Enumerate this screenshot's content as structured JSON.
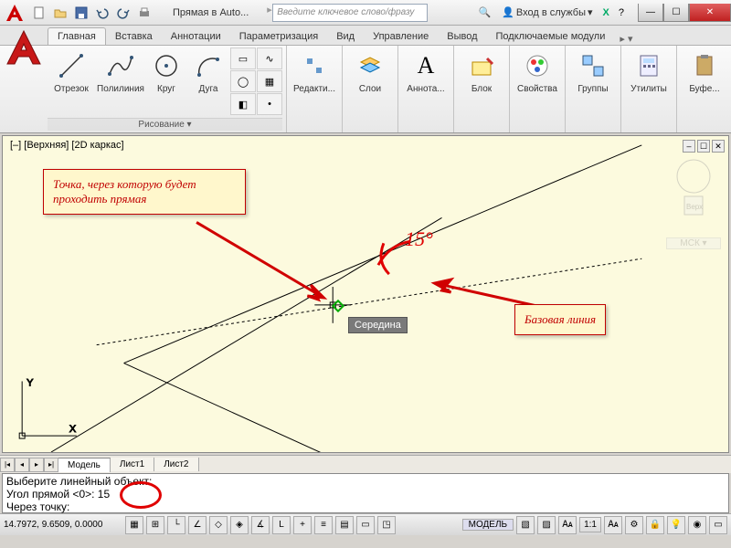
{
  "title": "Прямая в Auto...",
  "search_placeholder": "Введите ключевое слово/фразу",
  "login_label": "Вход в службы",
  "tabs": {
    "home": "Главная",
    "insert": "Вставка",
    "annotate": "Аннотации",
    "parametric": "Параметризация",
    "view": "Вид",
    "manage": "Управление",
    "output": "Вывод",
    "plugins": "Подключаемые модули"
  },
  "ribbon": {
    "draw_panel_title": "Рисование ▾",
    "line": "Отрезок",
    "polyline": "Полилиния",
    "circle": "Круг",
    "arc": "Дуга",
    "edit": "Редакти...",
    "layers": "Слои",
    "annot": "Аннота...",
    "block": "Блок",
    "props": "Свойства",
    "groups": "Группы",
    "utils": "Утилиты",
    "clipboard": "Буфе..."
  },
  "viewport_label": "[–] [Верхняя] [2D каркас]",
  "callout1": "Точка, через которую будет проходить прямая",
  "callout2": "Базовая линия",
  "angle_ann": "15°",
  "snap_label": "Середина",
  "wcs_label": "МСК ▾",
  "bottom_tabs": {
    "model": "Модель",
    "sheet1": "Лист1",
    "sheet2": "Лист2"
  },
  "cmd": {
    "l1": "Выберите линейный объект:",
    "l2": "Угол прямой <0>: 15",
    "l3": "Через точку:"
  },
  "status": {
    "coords": "14.7972, 9.6509, 0.0000",
    "model": "МОДЕЛЬ",
    "scale": "1:1"
  }
}
